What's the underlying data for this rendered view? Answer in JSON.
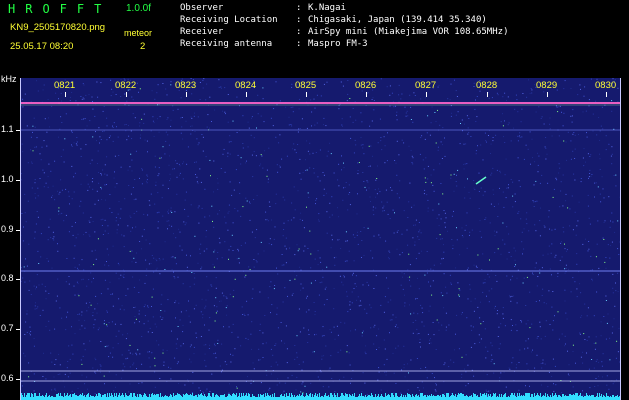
{
  "header": {
    "app_title": "HROFFT",
    "app_version": "1.0.0f",
    "file_name": "KN9_2505170820.png",
    "date_time": "25.05.17 08:20",
    "meteor_label": "meteor",
    "meteor_count": "2"
  },
  "info": [
    {
      "label": "Observer",
      "sep": ":",
      "value": "K.Nagai"
    },
    {
      "label": "Receiving Location",
      "sep": ":",
      "value": "Chigasaki, Japan (139.414 35.340)"
    },
    {
      "label": "Receiver",
      "sep": ":",
      "value": "AirSpy mini (Miakejima VOR 108.65MHz)"
    },
    {
      "label": "Receiving antenna",
      "sep": ":",
      "value": "Maspro FM-3"
    }
  ],
  "y_axis": {
    "unit": "kHz",
    "ticks": [
      "1.1",
      "1.0",
      "0.9",
      "0.8",
      "0.7",
      "0.6"
    ]
  },
  "x_axis": {
    "ticks": [
      "0821",
      "0822",
      "0823",
      "0824",
      "0825",
      "0826",
      "0827",
      "0828",
      "0829",
      "0830"
    ]
  },
  "colors": {
    "background": "#000000",
    "plot_background": "#151a6e",
    "title_green": "#22ff44",
    "label_yellow": "#ffff33",
    "carrier_line": "#ff66cc",
    "bottom_noise": "#33ddff"
  }
}
